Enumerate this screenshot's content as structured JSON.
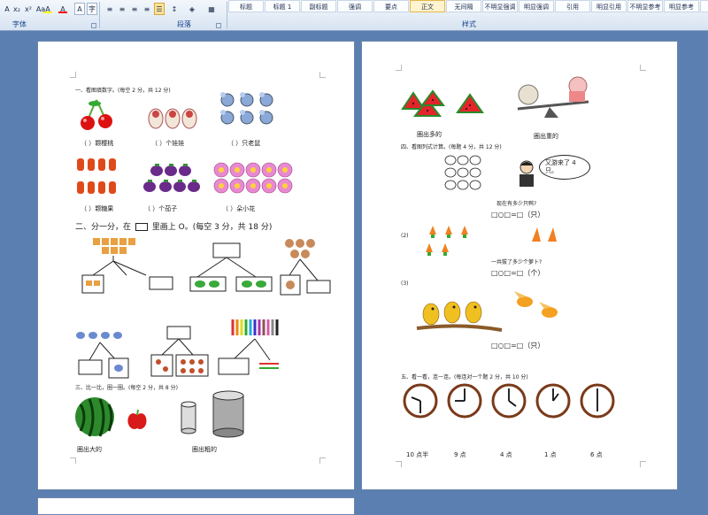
{
  "ribbon": {
    "font_group": {
      "label": "字体",
      "tools": [
        "A",
        "x₂",
        "x²",
        "Aa",
        "A",
        "A",
        "A",
        "字"
      ]
    },
    "paragraph_group": {
      "label": "段落",
      "tools": [
        "≡",
        "≡",
        "≡",
        "≡",
        "☰",
        "↕",
        "◈",
        "▦"
      ]
    },
    "styles_group": {
      "label": "样式",
      "styles": [
        "标题",
        "标题 1",
        "副标题",
        "强调",
        "要点",
        "正文",
        "无间隔",
        "不明显强调",
        "明显强调",
        "引用",
        "明显引用",
        "不明显参考",
        "明显参考",
        "书籍"
      ],
      "active_index": 5
    },
    "colors": {
      "ribbon_text": "#15428b",
      "highlight": "#ffff00",
      "font_color": "#ff0000"
    }
  },
  "left_page": {
    "q1_title": "一、看图填数字。(每空 2 分，共 12 分)",
    "q1_labels": [
      "（ ）颗樱桃",
      "（ ）个娃娃",
      "（ ）只老鼠",
      "（ ）颗糖果",
      "（ ）个茄子",
      "（ ）朵小花"
    ],
    "q2_title_prefix": "二、分一分，在",
    "q2_title_suffix": "里画上 O。(每空 3 分，共 18 分)",
    "q3_title": "三、比一比，圈一圈。(每空 2 分，共 8 分)",
    "q3_labels": [
      "圈出大的",
      "圈出粗的"
    ]
  },
  "right_page": {
    "top_labels": [
      "圈出多的",
      "圈出重的"
    ],
    "q4_title": "四、看图列式计算。(每题 4 分，共 12 分)",
    "speech": "又游来了 4 只。",
    "q4_1_question": "现在有多少只鸭?",
    "q4_1_formula": "□○□=□（只）",
    "q4_2_label": "(2)",
    "q4_2_question": "一共拔了多少个萝卜?",
    "q4_2_formula": "□○□=□（个）",
    "q4_3_label": "(3)",
    "q4_3_formula": "□○□=□（只）",
    "q5_title": "五、看一看，连一连。(每连对一个题 2 分，共 10 分)",
    "clock_times": [
      "10 点半",
      "9 点",
      "4 点",
      "1 点",
      "6 点"
    ]
  }
}
